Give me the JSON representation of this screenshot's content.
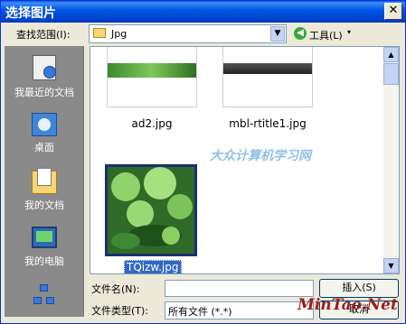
{
  "window": {
    "title": "选择图片",
    "close_glyph": "✕"
  },
  "toolbar": {
    "lookin_label": "查找范围(I):",
    "lookin_value": "Jpg",
    "tools_label": "工具(L)",
    "tools_arrow": "▾",
    "combo_arrow": "▼",
    "back_glyph": "◀"
  },
  "places": [
    {
      "label": "我最近的文档",
      "icon": "recent-documents-icon"
    },
    {
      "label": "桌面",
      "icon": "desktop-icon"
    },
    {
      "label": "我的文档",
      "icon": "my-documents-icon"
    },
    {
      "label": "我的电脑",
      "icon": "my-computer-icon"
    },
    {
      "label": "",
      "icon": "network-places-icon"
    }
  ],
  "files": [
    {
      "name": "ad2.jpg",
      "selected": false
    },
    {
      "name": "mbl-rtitle1.jpg",
      "selected": false
    },
    {
      "name": "TQizw.jpg",
      "selected": true
    }
  ],
  "watermark": "大众计算机学习网",
  "form": {
    "filename_label": "文件名(N):",
    "filename_value": "",
    "filetype_label": "文件类型(T):",
    "filetype_value": "所有文件 (*.*)",
    "insert_label": "插入(S)",
    "cancel_label": "取消"
  },
  "brand": "MinTao.Net",
  "colors": {
    "titlebar": "#0055e5",
    "selection": "#316ac5",
    "places_bg": "#8a8a8a"
  }
}
